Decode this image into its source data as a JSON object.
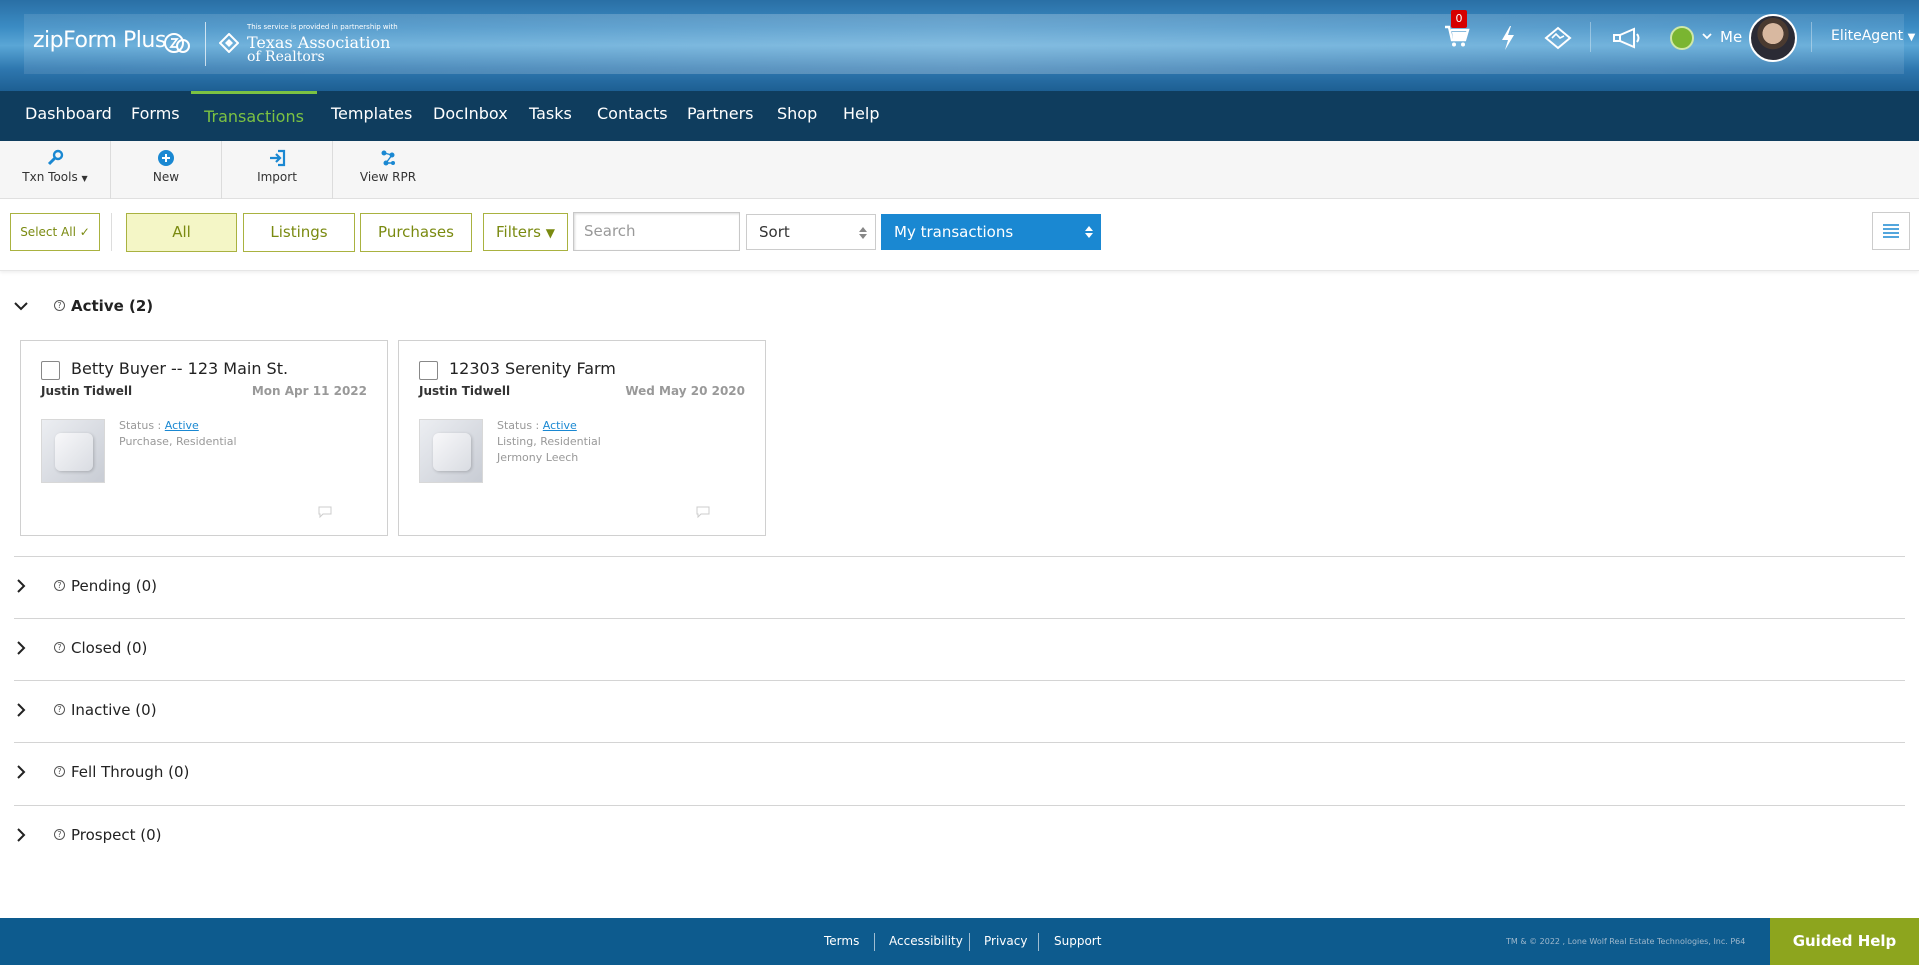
{
  "header": {
    "logo_text": "zipForm Plus",
    "partner_note": "This service is provided in partnership with",
    "partner_line1": "Texas Association",
    "partner_line2": "of Realtors",
    "cart_count": "0",
    "me_label": "Me",
    "user_name": "EliteAgent"
  },
  "nav": {
    "items": [
      {
        "label": "Dashboard"
      },
      {
        "label": "Forms"
      },
      {
        "label": "Transactions",
        "active": true
      },
      {
        "label": "Templates"
      },
      {
        "label": "DocInbox"
      },
      {
        "label": "Tasks"
      },
      {
        "label": "Contacts"
      },
      {
        "label": "Partners"
      },
      {
        "label": "Shop"
      },
      {
        "label": "Help"
      }
    ]
  },
  "toolbar": {
    "txn_tools": "Txn Tools",
    "new": "New",
    "import": "Import",
    "view_rpr": "View RPR"
  },
  "filters": {
    "select_all": "Select All",
    "all": "All",
    "listings": "Listings",
    "purchases": "Purchases",
    "filters": "Filters",
    "search_placeholder": "Search",
    "sort": "Sort",
    "scope": "My transactions"
  },
  "sections": [
    {
      "label": "Active (2)",
      "expanded": true
    },
    {
      "label": "Pending (0)"
    },
    {
      "label": "Closed (0)"
    },
    {
      "label": "Inactive (0)"
    },
    {
      "label": "Fell Through (0)"
    },
    {
      "label": "Prospect (0)"
    }
  ],
  "cards": [
    {
      "title": "Betty Buyer -- 123 Main St.",
      "agent": "Justin Tidwell",
      "date": "Mon Apr 11 2022",
      "status_label": "Status :",
      "status": "Active",
      "type": "Purchase, Residential",
      "extra": ""
    },
    {
      "title": "12303 Serenity Farm",
      "agent": "Justin Tidwell",
      "date": "Wed May 20 2020",
      "status_label": "Status :",
      "status": "Active",
      "type": "Listing, Residential",
      "extra": "Jermony Leech"
    }
  ],
  "footer": {
    "terms": "Terms",
    "accessibility": "Accessibility",
    "privacy": "Privacy",
    "support": "Support",
    "copyright": "TM & © 2022 , Lone Wolf Real Estate Technologies, Inc. P64",
    "guided_help": "Guided Help"
  },
  "colors": {
    "nav_bg": "#0f3d5e",
    "nav_active": "#7cc242",
    "accent_blue": "#1a88d2",
    "olive": "#a9b240",
    "footer_bg": "#0d5b8e",
    "guided_bg": "#8da51e"
  }
}
